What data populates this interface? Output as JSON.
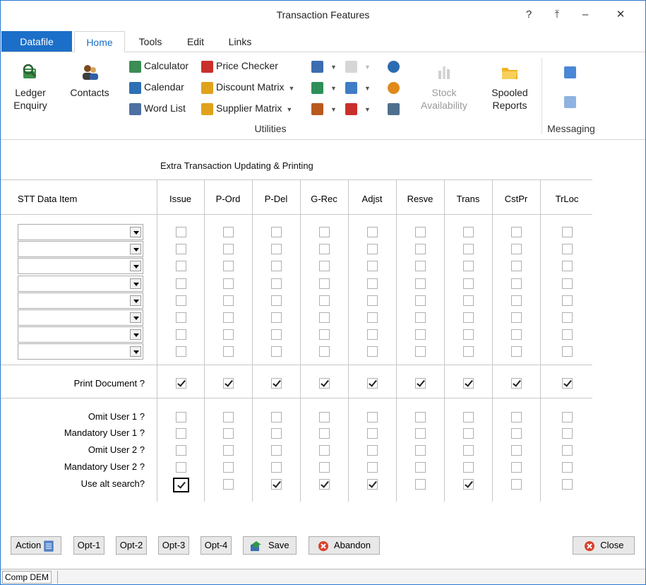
{
  "window": {
    "title": "Transaction Features",
    "help": "?",
    "restore": "⤒",
    "minimize": "–",
    "close": "✕"
  },
  "tabs": [
    "Datafile",
    "Home",
    "Tools",
    "Edit",
    "Links"
  ],
  "ribbon": {
    "ledger_enquiry": "Ledger Enquiry",
    "contacts": "Contacts",
    "calculator": "Calculator",
    "calendar": "Calendar",
    "word_list": "Word List",
    "price_checker": "Price Checker",
    "discount_matrix": "Discount Matrix",
    "supplier_matrix": "Supplier Matrix",
    "stock_availability": "Stock Availability",
    "spooled_reports": "Spooled Reports",
    "utilities_group": "Utilities",
    "messaging_group": "Messaging"
  },
  "grid": {
    "section_title": "Extra Transaction Updating & Printing",
    "data_item_header": "STT Data Item",
    "columns": [
      "Issue",
      "P-Ord",
      "P-Del",
      "G-Rec",
      "Adjst",
      "Resve",
      "Trans",
      "CstPr",
      "TrLoc"
    ],
    "data_items": [
      "",
      "",
      "",
      "",
      "",
      "",
      "",
      ""
    ],
    "data_item_checks": [
      [
        false,
        false,
        false,
        false,
        false,
        false,
        false,
        false,
        false
      ],
      [
        false,
        false,
        false,
        false,
        false,
        false,
        false,
        false,
        false
      ],
      [
        false,
        false,
        false,
        false,
        false,
        false,
        false,
        false,
        false
      ],
      [
        false,
        false,
        false,
        false,
        false,
        false,
        false,
        false,
        false
      ],
      [
        false,
        false,
        false,
        false,
        false,
        false,
        false,
        false,
        false
      ],
      [
        false,
        false,
        false,
        false,
        false,
        false,
        false,
        false,
        false
      ],
      [
        false,
        false,
        false,
        false,
        false,
        false,
        false,
        false,
        false
      ],
      [
        false,
        false,
        false,
        false,
        false,
        false,
        false,
        false,
        false
      ]
    ],
    "print_row": {
      "label": "Print Document ?",
      "checks": [
        true,
        true,
        true,
        true,
        true,
        true,
        true,
        true,
        true
      ]
    },
    "option_rows": [
      {
        "label": "Omit User 1 ?",
        "checks": [
          false,
          false,
          false,
          false,
          false,
          false,
          false,
          false,
          false
        ]
      },
      {
        "label": "Mandatory User 1 ?",
        "checks": [
          false,
          false,
          false,
          false,
          false,
          false,
          false,
          false,
          false
        ]
      },
      {
        "label": "Omit User 2 ?",
        "checks": [
          false,
          false,
          false,
          false,
          false,
          false,
          false,
          false,
          false
        ]
      },
      {
        "label": "Mandatory User 2 ?",
        "checks": [
          false,
          false,
          false,
          false,
          false,
          false,
          false,
          false,
          false
        ]
      },
      {
        "label": "Use alt search?",
        "checks": [
          true,
          false,
          true,
          true,
          true,
          false,
          true,
          false,
          false
        ]
      }
    ]
  },
  "buttons": {
    "action": "Action",
    "opt1": "Opt-1",
    "opt2": "Opt-2",
    "opt3": "Opt-3",
    "opt4": "Opt-4",
    "save": "Save",
    "abandon": "Abandon",
    "close": "Close"
  },
  "status": {
    "company": "Comp DEM"
  },
  "colors": {
    "accent": "#1c6fc8",
    "border": "#c8c8c8"
  }
}
